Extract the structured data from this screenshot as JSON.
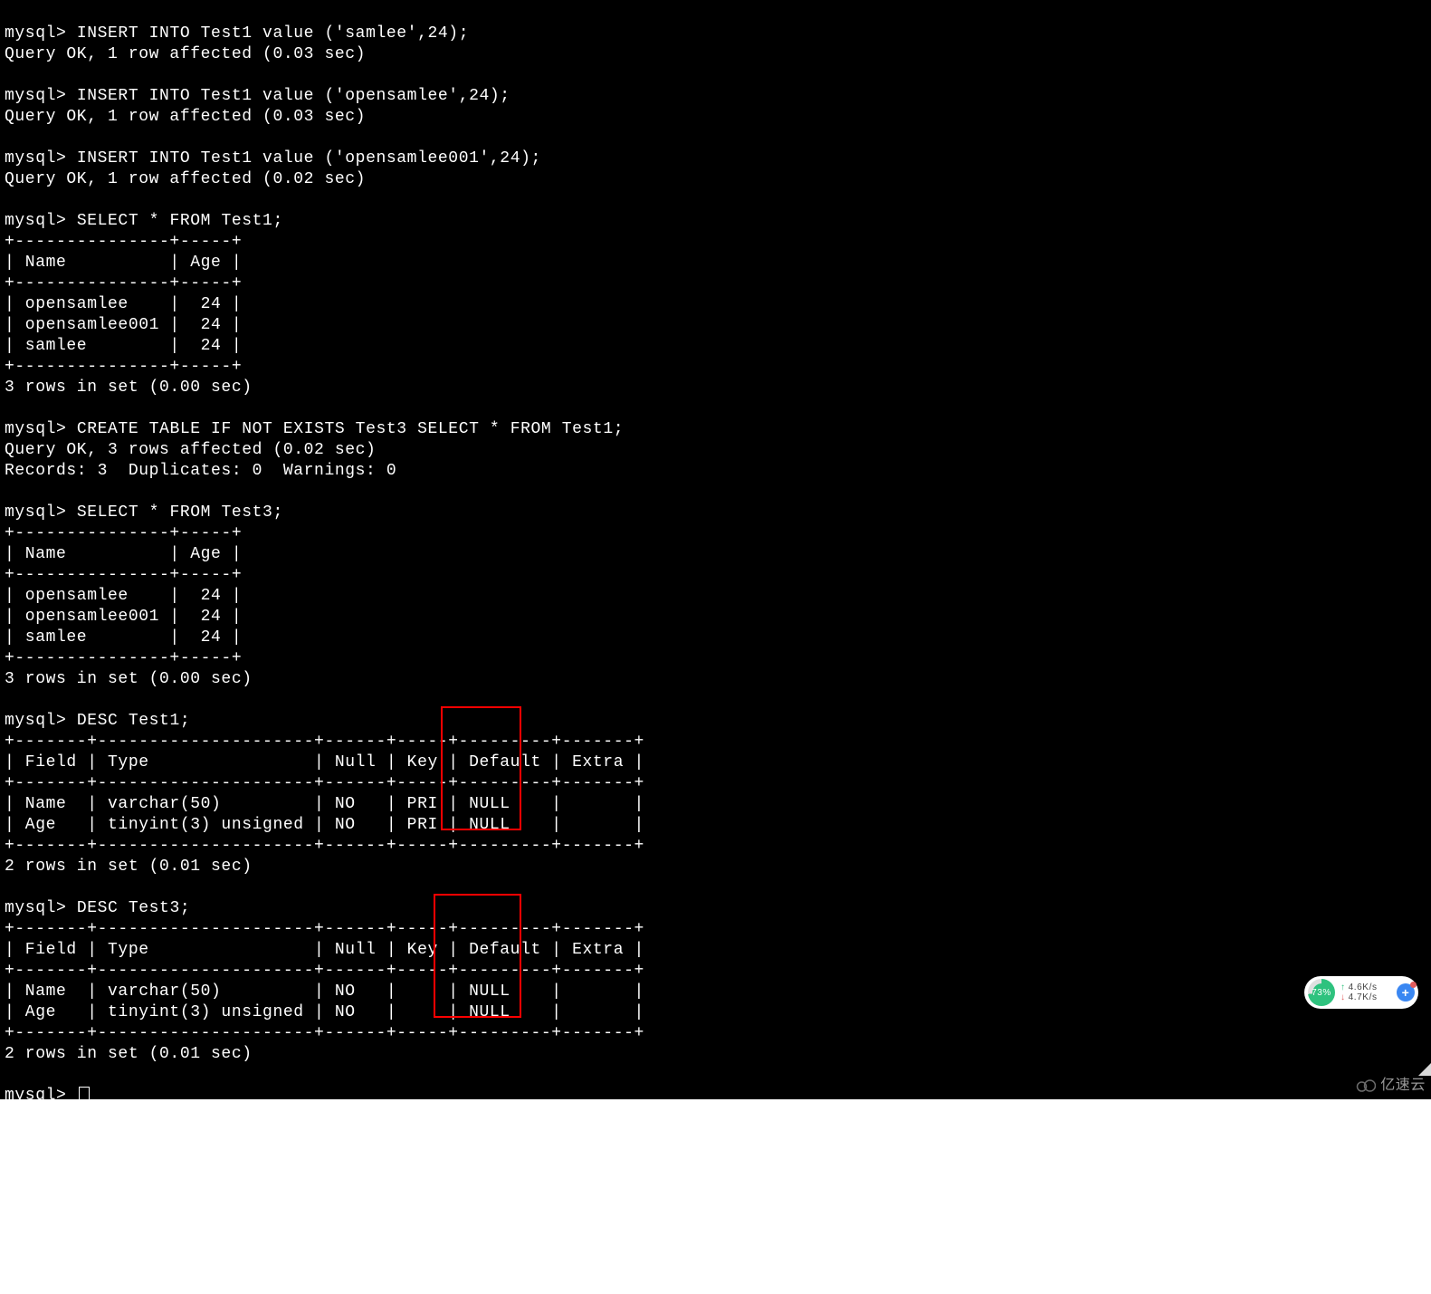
{
  "prompt": "mysql>",
  "insert1_cmd": " INSERT INTO Test1 value ('samlee',24);",
  "insert2_cmd": " INSERT INTO Test1 value ('opensamlee',24);",
  "insert3_cmd": " INSERT INTO Test1 value ('opensamlee001',24);",
  "ok_003": "Query OK, 1 row affected (0.03 sec)",
  "ok_002": "Query OK, 1 row affected (0.02 sec)",
  "select1_cmd": " SELECT * FROM Test1;",
  "select3_cmd": " SELECT * FROM Test3;",
  "tbl_sep": "+---------------+-----+",
  "tbl_head": "| Name          | Age |",
  "tbl_r1": "| opensamlee    |  24 |",
  "tbl_r2": "| opensamlee001 |  24 |",
  "tbl_r3": "| samlee        |  24 |",
  "rows3": "3 rows in set (0.00 sec)",
  "create_cmd": " CREATE TABLE IF NOT EXISTS Test3 SELECT * FROM Test1;",
  "create_ok": "Query OK, 3 rows affected (0.02 sec)",
  "records": "Records: 3  Duplicates: 0  Warnings: 0",
  "desc1_cmd": " DESC Test1;",
  "desc3_cmd": " DESC Test3;",
  "d_sep": "+-------+---------------------+------+-----+---------+-------+",
  "d_head": "| Field | Type                | Null | Key | Default | Extra |",
  "d1_r1": "| Name  | varchar(50)         | NO   | PRI | NULL    |       |",
  "d1_r2": "| Age   | tinyint(3) unsigned | NO   | PRI | NULL    |       |",
  "d3_r1": "| Name  | varchar(50)         | NO   |     | NULL    |       |",
  "d3_r2": "| Age   | tinyint(3) unsigned | NO   |     | NULL    |       |",
  "rows2": "2 rows in set (0.01 sec)",
  "widget": {
    "percent": "73%",
    "up": "4.6K/s",
    "down": "4.7K/s"
  },
  "watermark": "亿速云"
}
